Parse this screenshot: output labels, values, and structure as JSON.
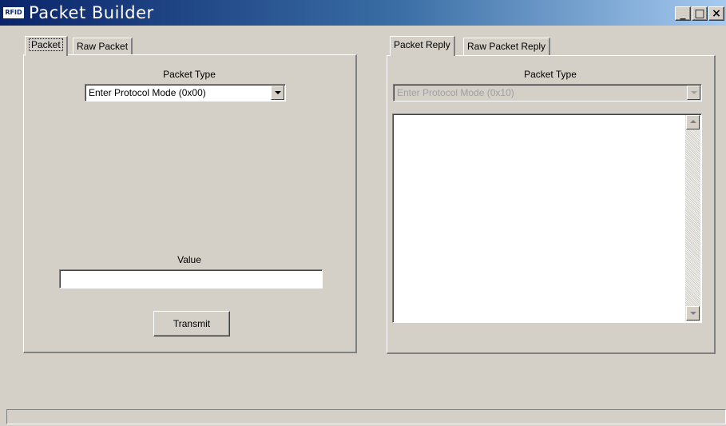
{
  "window": {
    "title": "Packet Builder",
    "app_icon_text": "RFID",
    "minimize_label": "_",
    "maximize_label": "□",
    "close_label": "×"
  },
  "left_panel": {
    "tabs": [
      {
        "label": "Packet",
        "active": true
      },
      {
        "label": "Raw Packet",
        "active": false
      }
    ],
    "packet_type_label": "Packet Type",
    "packet_type_value": "Enter Protocol Mode (0x00)",
    "value_label": "Value",
    "value_input": "",
    "transmit_label": "Transmit"
  },
  "right_panel": {
    "tabs": [
      {
        "label": "Packet Reply",
        "active": true
      },
      {
        "label": "Raw Packet Reply",
        "active": false
      }
    ],
    "packet_type_label": "Packet Type",
    "packet_type_value": "Enter Protocol Mode (0x10)",
    "reply_text": ""
  },
  "status_bar": {
    "text": ""
  }
}
